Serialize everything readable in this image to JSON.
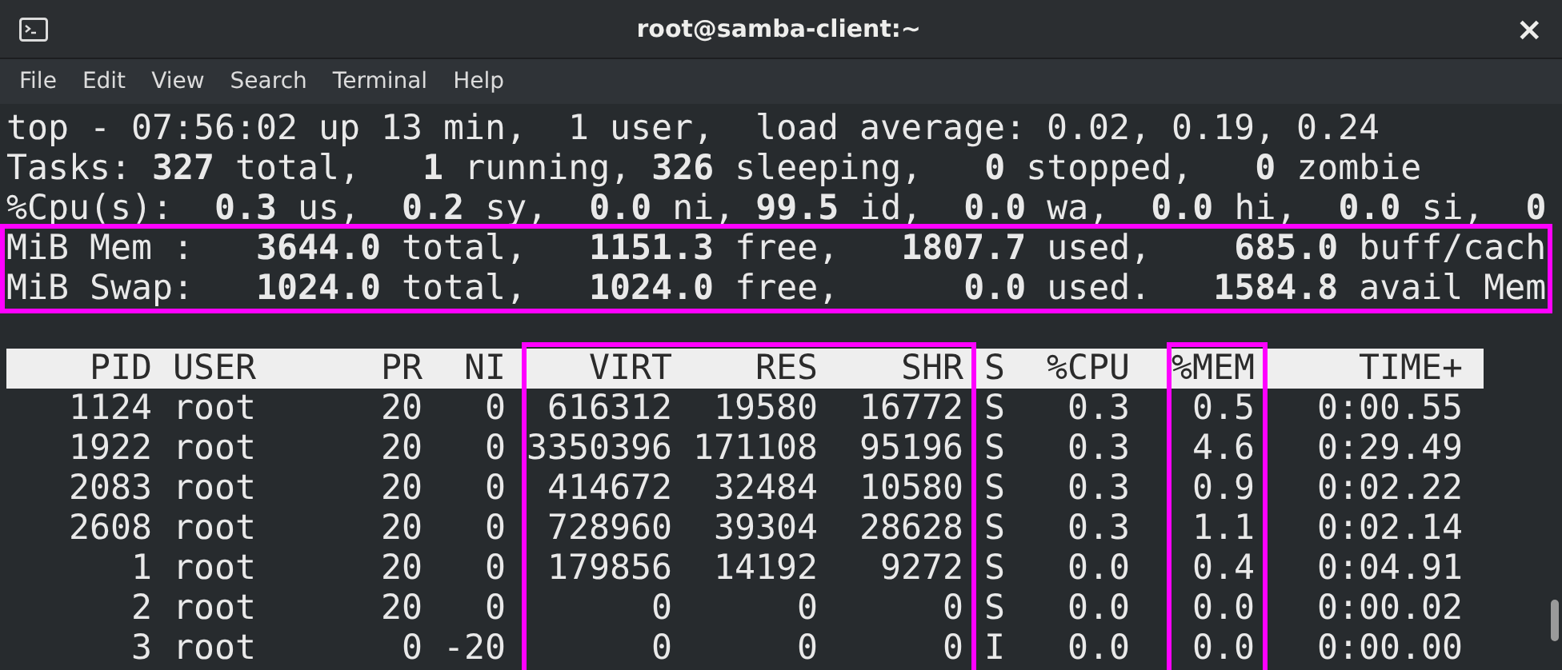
{
  "window": {
    "title": "root@samba-client:~",
    "close_glyph": "×"
  },
  "menu": [
    "File",
    "Edit",
    "View",
    "Search",
    "Terminal",
    "Help"
  ],
  "summary_lines": [
    {
      "text": "top - 07:56:02 up 13 min,  1 user,  load average: 0.02, 0.19, 0.24",
      "highlighted": false
    },
    {
      "text": "Tasks: **327** total,   **1** running, **326** sleeping,   **0** stopped,   **0** zombie",
      "highlighted": false
    },
    {
      "text": "%Cpu(s):  **0.3** us,  **0.2** sy,  **0.0** ni, **99.5** id,  **0.0** wa,  **0.0** hi,  **0.0** si,  **0**",
      "highlighted": false
    },
    {
      "text": "MiB Mem :   **3644.0** total,   **1151.3** free,   **1807.7** used,    **685.0** buff/cach",
      "highlighted": true
    },
    {
      "text": "MiB Swap:   **1024.0** total,   **1024.0** free,      **0.0** used.   **1584.8** avail Mem",
      "highlighted": true
    }
  ],
  "table": {
    "columns": [
      {
        "label": "PID",
        "highlighted": false
      },
      {
        "label": "USER",
        "highlighted": false
      },
      {
        "label": "PR",
        "highlighted": false
      },
      {
        "label": "NI",
        "highlighted": false
      },
      {
        "label": "VIRT",
        "highlighted": true
      },
      {
        "label": "RES",
        "highlighted": true
      },
      {
        "label": "SHR",
        "highlighted": true
      },
      {
        "label": "S",
        "highlighted": false
      },
      {
        "label": "%CPU",
        "highlighted": false
      },
      {
        "label": "%MEM",
        "highlighted": true
      },
      {
        "label": "TIME+",
        "highlighted": false
      }
    ],
    "rows": [
      [
        "1124",
        "root",
        "20",
        "0",
        "616312",
        "19580",
        "16772",
        "S",
        "0.3",
        "0.5",
        "0:00.55"
      ],
      [
        "1922",
        "root",
        "20",
        "0",
        "3350396",
        "171108",
        "95196",
        "S",
        "0.3",
        "4.6",
        "0:29.49"
      ],
      [
        "2083",
        "root",
        "20",
        "0",
        "414672",
        "32484",
        "10580",
        "S",
        "0.3",
        "0.9",
        "0:02.22"
      ],
      [
        "2608",
        "root",
        "20",
        "0",
        "728960",
        "39304",
        "28628",
        "S",
        "0.3",
        "1.1",
        "0:02.14"
      ],
      [
        "1",
        "root",
        "20",
        "0",
        "179856",
        "14192",
        "9272",
        "S",
        "0.0",
        "0.4",
        "0:04.91"
      ],
      [
        "2",
        "root",
        "20",
        "0",
        "0",
        "0",
        "0",
        "S",
        "0.0",
        "0.0",
        "0:00.02"
      ],
      [
        "3",
        "root",
        "0",
        "-20",
        "0",
        "0",
        "0",
        "I",
        "0.0",
        "0.0",
        "0:00.00"
      ]
    ]
  }
}
